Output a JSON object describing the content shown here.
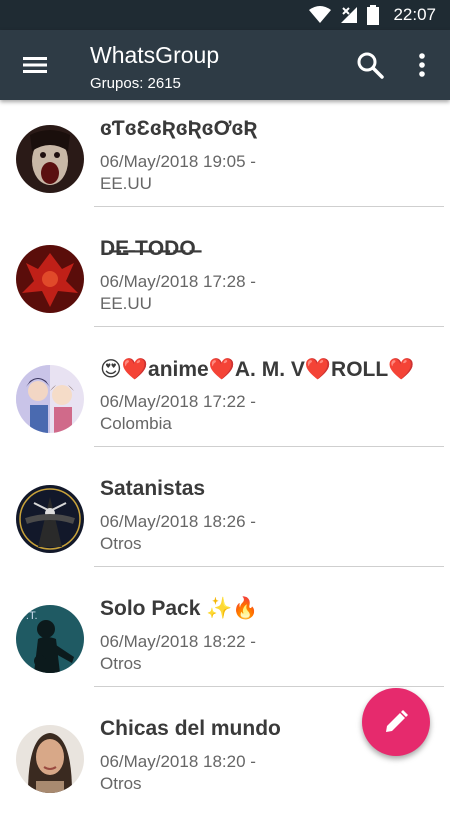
{
  "status_bar": {
    "time": "22:07"
  },
  "app_bar": {
    "title": "WhatsGroup",
    "subtitle": "Grupos: 2615",
    "icons": [
      "menu-icon",
      "search-icon",
      "more-vert-icon"
    ]
  },
  "groups": [
    {
      "name": "ɞƬɞƐɞƦɞƦɞƠɞƦ",
      "date": "06/May/2018 19:05 -",
      "country": "EE.UU"
    },
    {
      "name": "D̶E̶ ̶T̶O̶D̶O̶",
      "date": "06/May/2018 17:28 -",
      "country": "EE.UU"
    },
    {
      "name": "😍❤️anime❤️A. M. V❤️ROLL❤️",
      "date": "06/May/2018 17:22 -",
      "country": "Colombia"
    },
    {
      "name": "Satanistas",
      "date": "06/May/2018 18:26 -",
      "country": "Otros"
    },
    {
      "name": "Solo Pack ✨🔥",
      "date": "06/May/2018 18:22 -",
      "country": "Otros"
    },
    {
      "name": "Chicas del mundo",
      "date": "06/May/2018 18:20 -",
      "country": "Otros"
    }
  ],
  "colors": {
    "appbar": "#2e3b45",
    "statusbar": "#1f2b33",
    "fab": "#e62a6d"
  }
}
